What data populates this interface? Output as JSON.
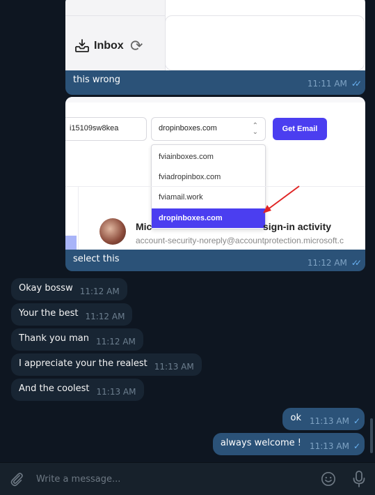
{
  "screenshot1": {
    "inbox_label": "Inbox",
    "caption": "this wrong",
    "time": "11:11 AM"
  },
  "screenshot2": {
    "email_prefix": "i15109sw8kea",
    "selected_domain": "dropinboxes.com",
    "get_email_label": "Get Email",
    "domain_options": [
      "fviainboxes.com",
      "fviadropinbox.com",
      "fviamail.work",
      "dropinboxes.com"
    ],
    "mail_subject_start": "Mic",
    "mail_subject_end": "sign-in activity",
    "mail_from": "account-security-noreply@accountprotection.microsoft.c",
    "caption": "select this",
    "time": "11:12 AM"
  },
  "incoming": [
    {
      "text": "Okay bossw",
      "time": "11:12 AM"
    },
    {
      "text": "Your the best",
      "time": "11:12 AM"
    },
    {
      "text": "Thank you man",
      "time": "11:12 AM"
    },
    {
      "text": "I appreciate your the realest",
      "time": "11:13 AM"
    },
    {
      "text": "And the coolest",
      "time": "11:13 AM"
    }
  ],
  "outgoing": [
    {
      "text": "ok",
      "time": "11:13 AM"
    },
    {
      "text": "always welcome !",
      "time": "11:13 AM"
    }
  ],
  "composer": {
    "placeholder": "Write a message..."
  },
  "colors": {
    "background": "#0e1621",
    "incoming_bubble": "#182533",
    "outgoing_bubble": "#2b5278",
    "accent": "#4b3ef0",
    "read_ticks": "#6ab3f3"
  }
}
